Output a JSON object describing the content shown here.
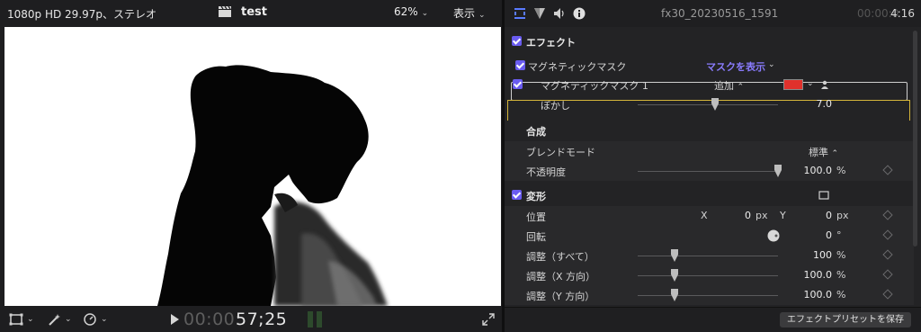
{
  "viewer": {
    "format": "1080p HD 29.97p、ステレオ",
    "project_name": "test",
    "zoom": "62%",
    "view_menu": "表示",
    "timecode_dim": "00:00:",
    "timecode": "57;25"
  },
  "inspector": {
    "clip_name": "fx30_20230516_1591",
    "duration_dim": "00:00:0",
    "duration": "4:16",
    "tabs": [
      "video-inspector-icon",
      "color-inspector-icon",
      "audio-inspector-icon",
      "info-inspector-icon"
    ],
    "effects_header": "エフェクト",
    "magnetic_mask": {
      "title": "マグネティックマスク",
      "show_mask": "マスクを表示",
      "mask_name": "マグネティックマスク 1",
      "mode": "追加",
      "color": "#e0312c",
      "feather_label": "ぼかし",
      "feather_value": "7.0",
      "feather_level": 0.55
    },
    "compositing": {
      "header": "合成",
      "blend_label": "ブレンドモード",
      "blend_value": "標準",
      "opacity_label": "不透明度",
      "opacity_value": "100.0",
      "opacity_unit": "%",
      "opacity_level": 1.0
    },
    "transform": {
      "header": "変形",
      "position_label": "位置",
      "x_label": "X",
      "x_value": "0",
      "x_unit": "px",
      "y_label": "Y",
      "y_value": "0",
      "y_unit": "px",
      "rotation_label": "回転",
      "rotation_value": "0",
      "rotation_unit": "°",
      "scale_all_label": "調整（すべて）",
      "scale_all_value": "100",
      "scale_all_unit": "%",
      "scale_x_label": "調整（X 方向）",
      "scale_x_value": "100.0",
      "scale_x_unit": "%",
      "scale_y_label": "調整（Y 方向）",
      "scale_y_value": "100.0",
      "scale_y_unit": "%",
      "scale_level": 0.26
    },
    "save_preset": "エフェクトプリセットを保存"
  },
  "colors": {
    "accent_checkbox": "#6a5cf0",
    "show_mask": "#8a7cff",
    "highlight": "#d4b43a"
  }
}
